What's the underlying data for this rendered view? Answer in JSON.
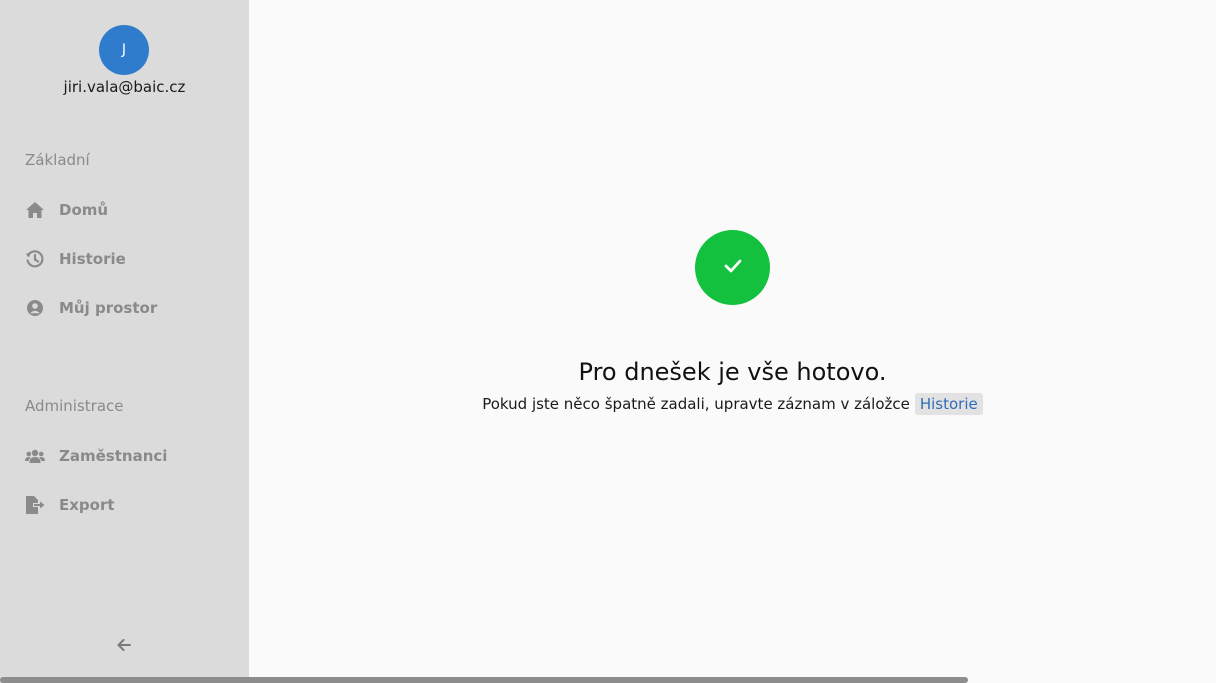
{
  "user": {
    "avatar_initial": "J",
    "email": "jiri.vala@baic.cz"
  },
  "sidebar": {
    "sections": [
      {
        "label": "Základní",
        "items": [
          {
            "label": "Domů",
            "icon": "home-icon"
          },
          {
            "label": "Historie",
            "icon": "history-icon"
          },
          {
            "label": "Můj prostor",
            "icon": "user-circle-icon"
          }
        ]
      },
      {
        "label": "Administrace",
        "items": [
          {
            "label": "Zaměstnanci",
            "icon": "users-icon"
          },
          {
            "label": "Export",
            "icon": "file-export-icon"
          }
        ]
      }
    ],
    "collapse_icon": "arrow-left-icon"
  },
  "main": {
    "status_icon": "check-icon",
    "title": "Pro dnešek je vše hotovo.",
    "subtitle": "Pokud jste něco špatně zadali, upravte záznam v záložce",
    "history_link": "Historie"
  },
  "colors": {
    "sidebar_bg": "#dbdbdb",
    "avatar": "#2f7bcc",
    "success": "#13c13f",
    "link": "#2f6db5"
  }
}
